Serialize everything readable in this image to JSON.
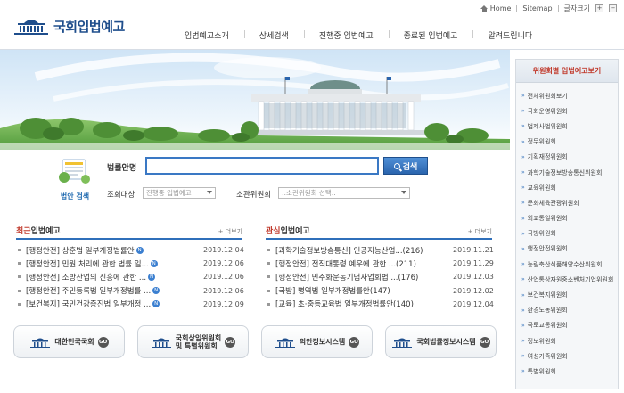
{
  "util": {
    "home": "Home",
    "sitemap": "Sitemap",
    "font_size": "글자크기",
    "plus": "+",
    "minus": "−"
  },
  "logo": {
    "title": "국회입법예고"
  },
  "gnb": [
    "입법예고소개",
    "상세검색",
    "진행중 입법예고",
    "종료된 입법예고",
    "알려드립니다"
  ],
  "search": {
    "guide_label": "법안 검색",
    "label": "법률안명",
    "button": "검색",
    "target_label": "조회대상",
    "target_value": "진행중 입법예고",
    "committee_label": "소관위원회",
    "committee_value": "::소관위원회 선택::"
  },
  "recent": {
    "title_hl": "최근",
    "title_rest": "입법예고",
    "more": "+ 더보기",
    "items": [
      {
        "title": "[행정안전] 상훈법 일부개정법률안",
        "date": "2019.12.04"
      },
      {
        "title": "[행정안전] 민원 처리에 관한 법률 일...",
        "date": "2019.12.06"
      },
      {
        "title": "[행정안전] 소방산업의 진흥에 관한 ...",
        "date": "2019.12.06"
      },
      {
        "title": "[행정안전] 주민등록법 일부개정법률 ...",
        "date": "2019.12.06"
      },
      {
        "title": "[보건복지] 국민건강증진법 일부개정 ...",
        "date": "2019.12.09"
      }
    ]
  },
  "interest": {
    "title_hl": "관심",
    "title_rest": "입법예고",
    "more": "+ 더보기",
    "items": [
      {
        "title": "[과학기술정보방송통신] 인공지능산업...(216)",
        "date": "2019.11.21"
      },
      {
        "title": "[행정안전] 전직대통령 예우에 관한 ...(211)",
        "date": "2019.11.29"
      },
      {
        "title": "[행정안전] 민주화운동기념사업회법 ...(176)",
        "date": "2019.12.03"
      },
      {
        "title": "[국방] 병역법 일부개정법률안(147)",
        "date": "2019.12.02"
      },
      {
        "title": "[교육] 초·중등교육법 일부개정법률안(140)",
        "date": "2019.12.04"
      }
    ]
  },
  "new_badge": "N",
  "go": "GO",
  "banners": [
    {
      "line1": "대한민국국회",
      "line2": ""
    },
    {
      "line1": "국회상임위원회",
      "line2": "및 특별위원회"
    },
    {
      "line1": "의안정보시스템",
      "line2": ""
    },
    {
      "line1": "국회법률정보시스템",
      "line2": ""
    }
  ],
  "side": {
    "title": "위원회별 입법예고보기",
    "items": [
      "전체위원회보기",
      "국회운영위원회",
      "법제사법위원회",
      "정무위원회",
      "기획재정위원회",
      "과학기술정보방송통신위원회",
      "교육위원회",
      "문화체육관광위원회",
      "외교통일위원회",
      "국방위원회",
      "행정안전위원회",
      "농림축산식품해양수산위원회",
      "산업통상자원중소벤처기업위원회",
      "보건복지위원회",
      "환경노동위원회",
      "국토교통위원회",
      "정보위원회",
      "여성가족위원회",
      "특별위원회"
    ]
  }
}
